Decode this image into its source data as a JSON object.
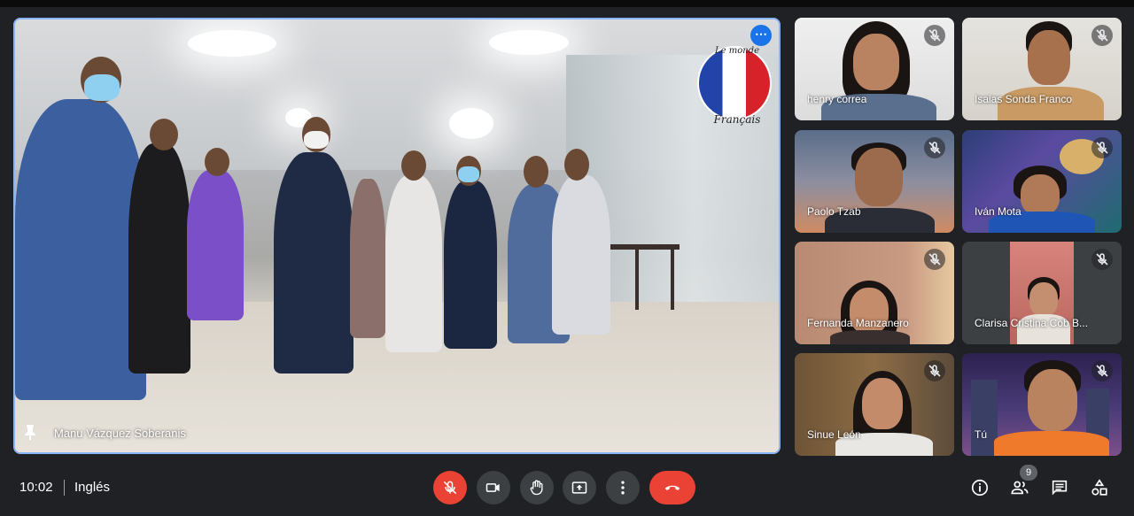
{
  "main": {
    "speaker_name": "Manu Vázquez Soberanis",
    "logo_title": "Le monde",
    "logo_sub": "Français"
  },
  "participants": [
    {
      "name": "henry correa",
      "muted": true
    },
    {
      "name": "Isaias Sonda Franco",
      "muted": true
    },
    {
      "name": "Paolo Tzab",
      "muted": true
    },
    {
      "name": "Iván Mota",
      "muted": true
    },
    {
      "name": "Fernanda Manzanero",
      "muted": true
    },
    {
      "name": "Clarisa Cristina Cob B...",
      "muted": true
    },
    {
      "name": "Sinue León",
      "muted": true
    },
    {
      "name": "Tú",
      "muted": true
    }
  ],
  "bottom": {
    "time": "10:02",
    "meeting": "Inglés",
    "participants_count": "9"
  },
  "colors": {
    "background": "#202124",
    "tile": "#3c4043",
    "active_border": "#8ab4f8",
    "danger": "#ea4335"
  },
  "icons": {
    "mic": "mic-off-icon",
    "camera": "videocam-icon",
    "hand": "raise-hand-icon",
    "present": "present-screen-icon",
    "more": "more-vert-icon",
    "hangup": "call-end-icon",
    "info": "info-icon",
    "people": "people-icon",
    "chat": "chat-icon",
    "activities": "activities-icon"
  }
}
